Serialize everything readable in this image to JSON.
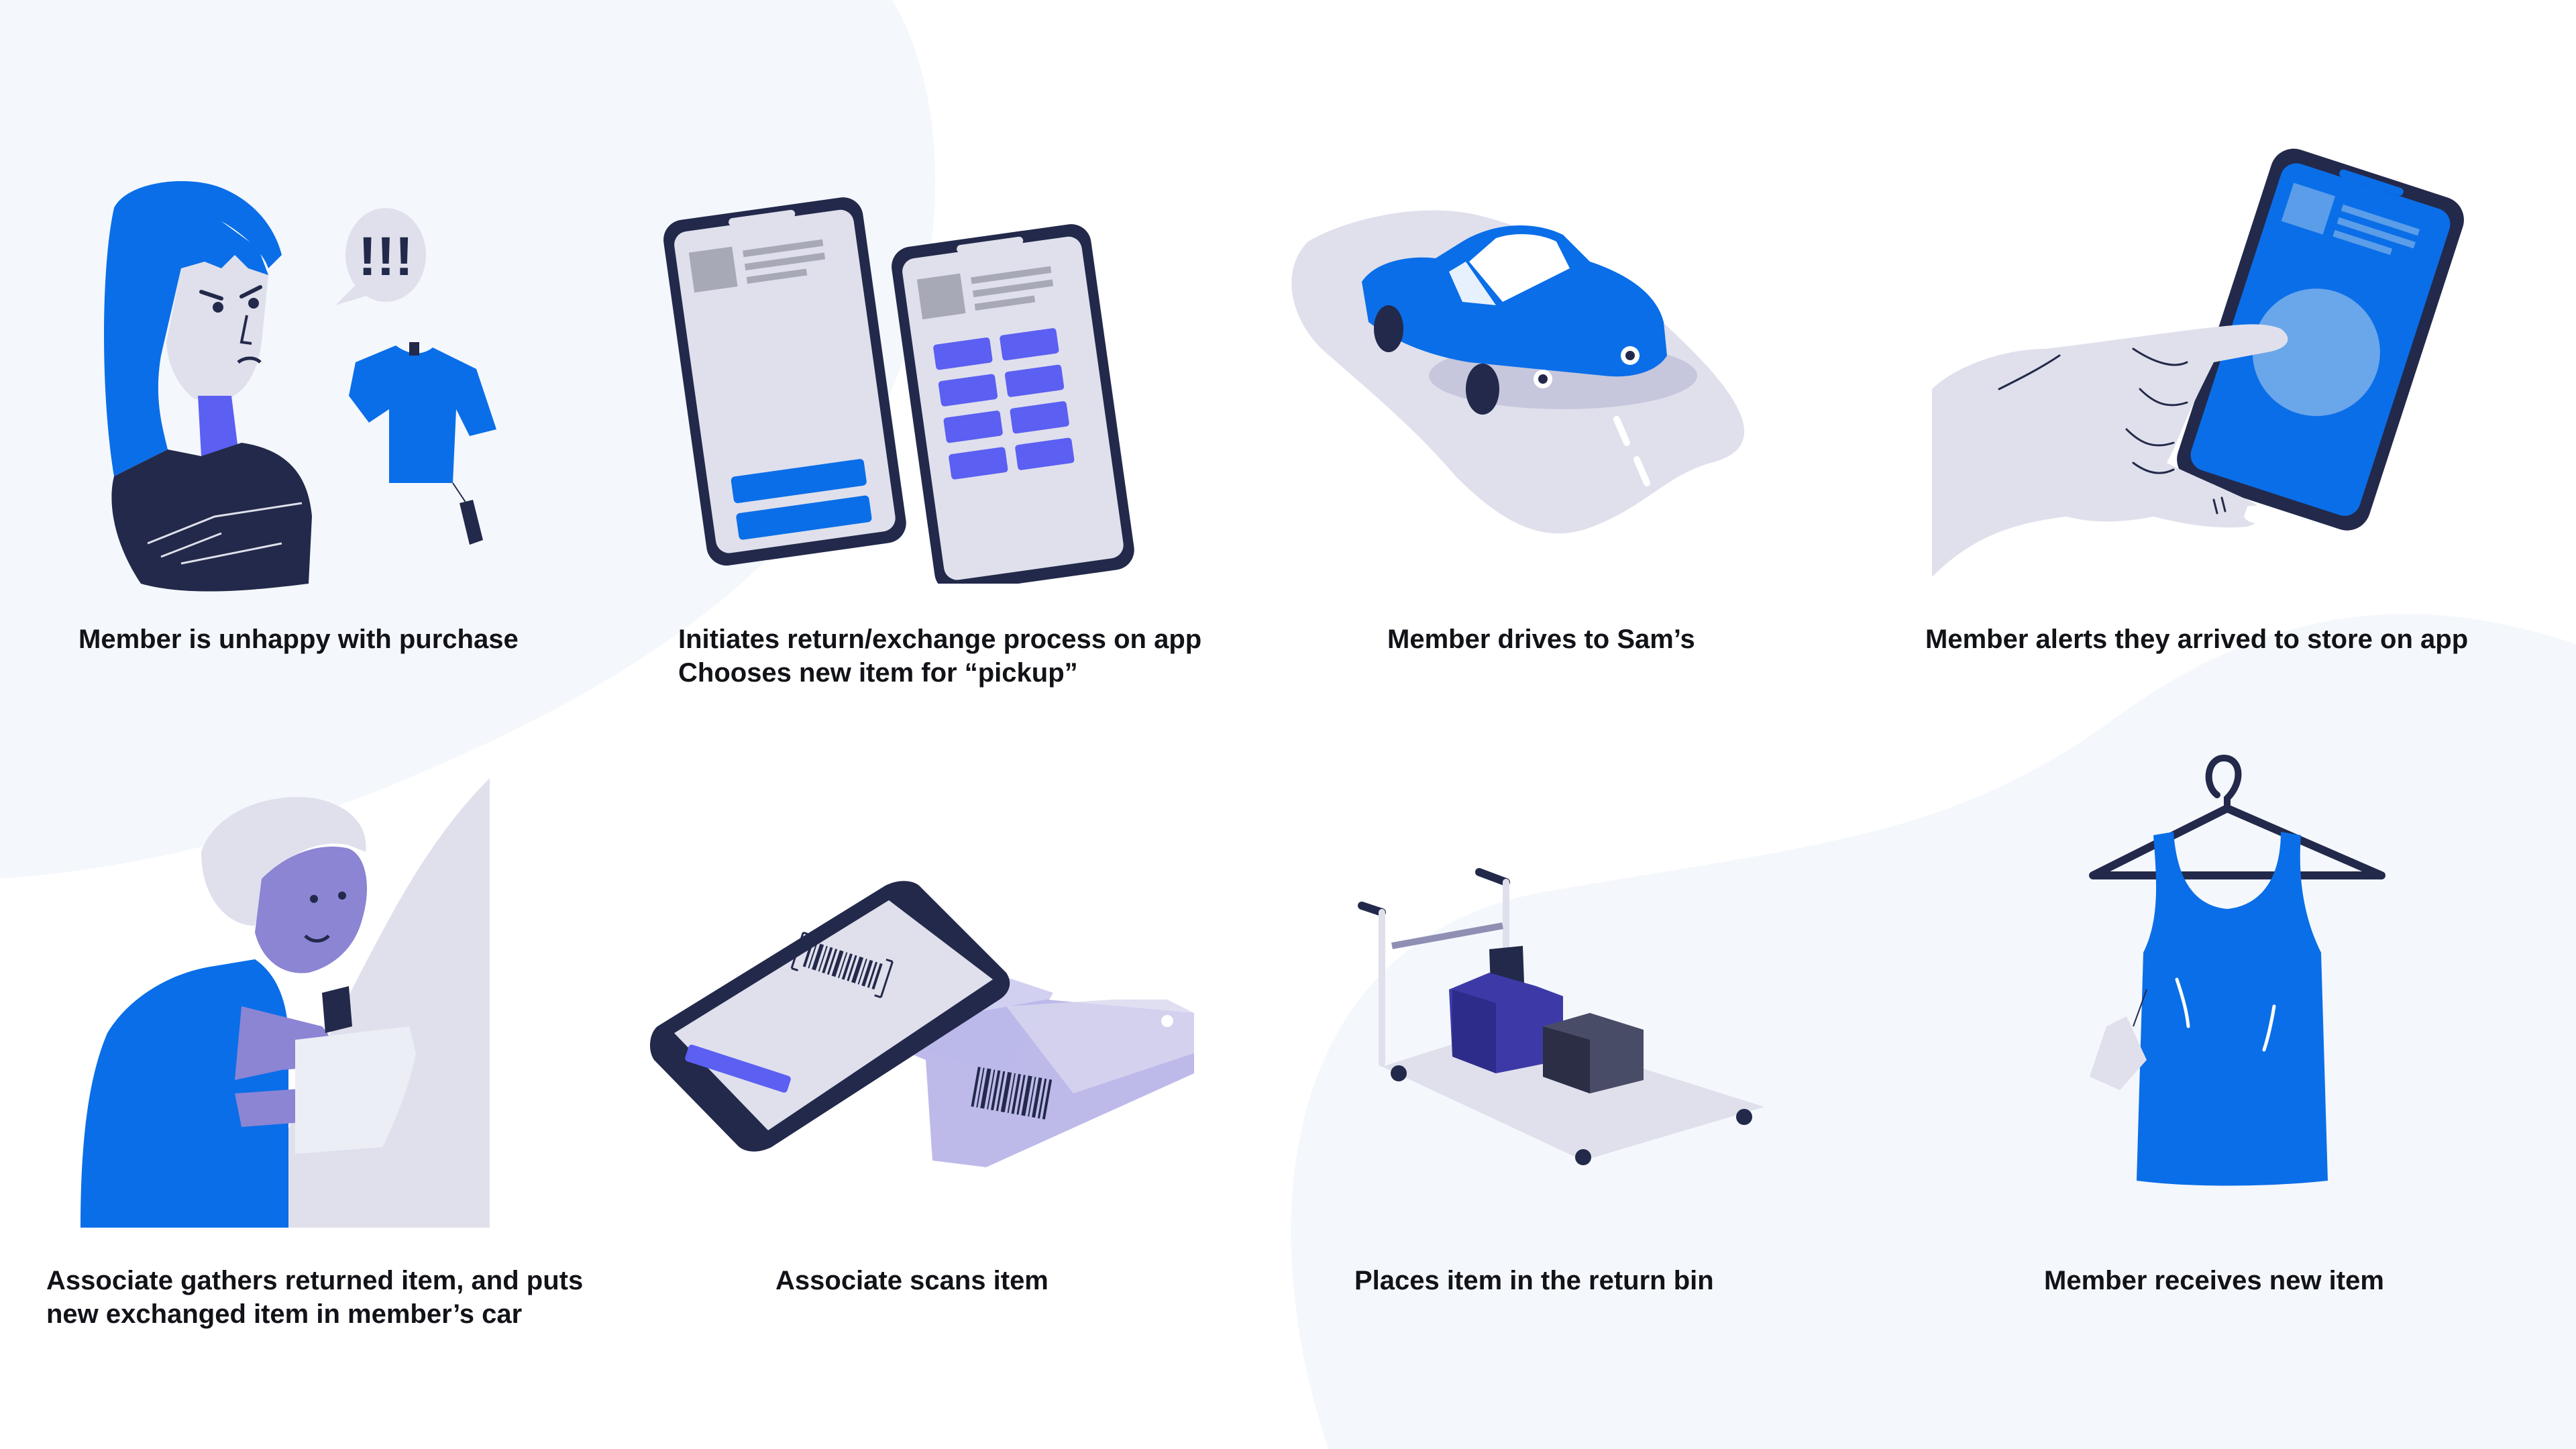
{
  "steps": [
    {
      "lines": [
        "Member is unhappy with purchase"
      ],
      "icon": "unhappy-member-icon"
    },
    {
      "lines": [
        "Initiates return/exchange process on app",
        "Chooses new item for “pickup”"
      ],
      "icon": "two-phones-icon"
    },
    {
      "lines": [
        "Member drives to Sam’s"
      ],
      "icon": "car-icon"
    },
    {
      "lines": [
        "Member alerts they arrived to store on app"
      ],
      "icon": "hand-tap-phone-icon"
    },
    {
      "lines": [
        "Associate gathers returned item, and puts",
        "new exchanged item in member’s car"
      ],
      "icon": "associate-icon"
    },
    {
      "lines": [
        "Associate scans item"
      ],
      "icon": "phone-scan-icon"
    },
    {
      "lines": [
        "Places item in the return bin"
      ],
      "icon": "cart-icon"
    },
    {
      "lines": [
        "Member receives new item"
      ],
      "icon": "tank-top-icon"
    }
  ],
  "speech_bubble": "!!!",
  "colors": {
    "brand_blue": "#0a6ee8",
    "navy": "#23294a",
    "indigo": "#5b5ff2",
    "lavender": "#dfe0ec",
    "background_blob": "#f4f7fc"
  }
}
